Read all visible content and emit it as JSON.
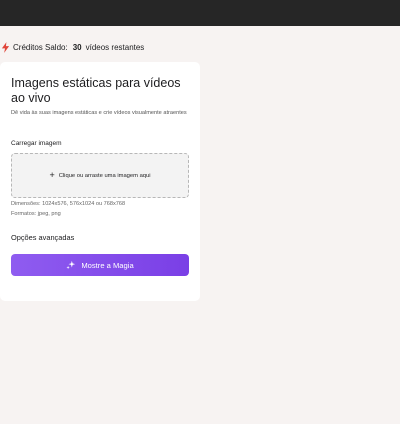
{
  "credits": {
    "label": "Créditos Saldo:",
    "count": "30",
    "suffix": "vídeos restantes"
  },
  "card": {
    "title": "Imagens estáticas para vídeos ao vivo",
    "description": "Dê vida às suas imagens estáticas e crie vídeos visualmente atraentes",
    "upload_label": "Carregar imagem",
    "dropzone_text": "Clique ou arraste uma imagem aqui",
    "dimensions": "Dimensões: 1024x576, 576x1024 ou 768x768",
    "formats": "Formatos: jpeg, png",
    "advanced": "Opções avançadas",
    "magic_button": "Mostre a Magia"
  },
  "colors": {
    "accent": "#7a3fe6",
    "bolt": "#e0453a",
    "topbar": "#262626"
  }
}
